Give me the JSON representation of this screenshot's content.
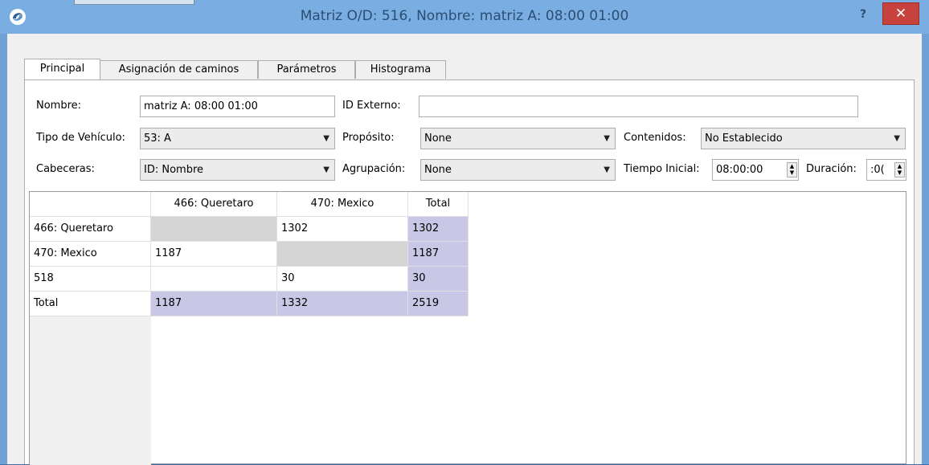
{
  "window": {
    "title": "Matriz O/D: 516, Nombre: matriz A: 08:00 01:00",
    "help_label": "?",
    "close_label": "✕"
  },
  "tabs": [
    "Principal",
    "Asignación de caminos",
    "Parámetros",
    "Histograma"
  ],
  "form": {
    "nombre_label": "Nombre:",
    "nombre_value": "matriz A: 08:00 01:00",
    "id_externo_label": "ID Externo:",
    "id_externo_value": "",
    "tipo_vehiculo_label": "Tipo de Vehículo:",
    "tipo_vehiculo_value": "53: A",
    "proposito_label": "Propósito:",
    "proposito_value": "None",
    "contenidos_label": "Contenidos:",
    "contenidos_value": "No Establecido",
    "cabeceras_label": "Cabeceras:",
    "cabeceras_value": "ID: Nombre",
    "agrupacion_label": "Agrupación:",
    "agrupacion_value": "None",
    "tiempo_inicial_label": "Tiempo Inicial:",
    "tiempo_inicial_value": "08:00:00",
    "duracion_label": "Duración:",
    "duracion_value": ":0("
  },
  "matrix": {
    "columns": [
      "466: Queretaro",
      "470: Mexico",
      "Total"
    ],
    "rows": [
      {
        "label": "466: Queretaro",
        "cells": [
          "",
          "1302",
          "1302"
        ]
      },
      {
        "label": "470: Mexico",
        "cells": [
          "1187",
          "",
          "1187"
        ]
      },
      {
        "label": "518",
        "cells": [
          "",
          "30",
          "30"
        ]
      },
      {
        "label": "Total",
        "cells": [
          "1187",
          "1332",
          "2519"
        ]
      }
    ]
  },
  "colors": {
    "titlebar": "#7aaee2",
    "close_button": "#c8423d",
    "total_cell": "#c8c8e6",
    "diagonal_cell": "#d4d4d4"
  }
}
